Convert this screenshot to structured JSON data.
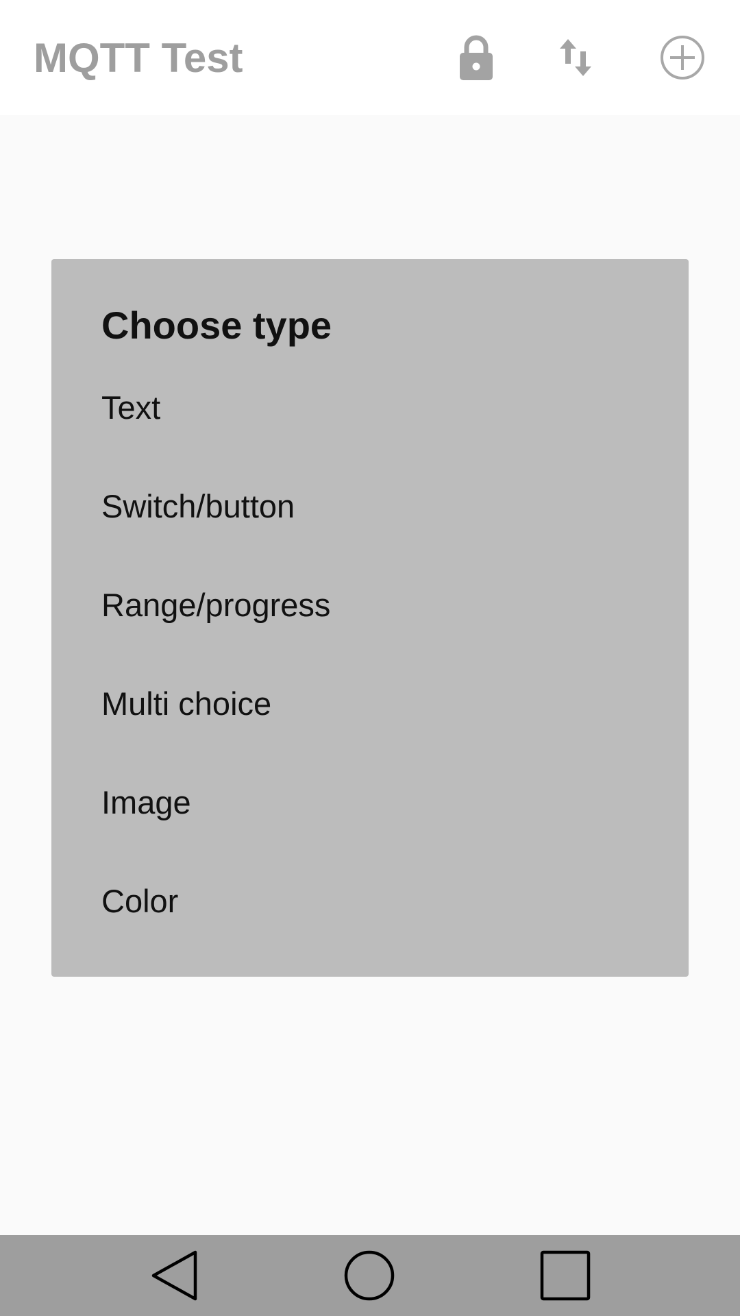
{
  "app_bar": {
    "title": "MQTT Test",
    "actions": [
      {
        "icon": "lock-icon"
      },
      {
        "icon": "swap-vertical-icon"
      },
      {
        "icon": "add-circle-icon"
      }
    ]
  },
  "dialog": {
    "title": "Choose type",
    "options": [
      "Text",
      "Switch/button",
      "Range/progress",
      "Multi choice",
      "Image",
      "Color"
    ]
  },
  "nav_bar": {
    "buttons": [
      {
        "icon": "back-triangle-icon"
      },
      {
        "icon": "home-circle-icon"
      },
      {
        "icon": "recents-square-icon"
      }
    ]
  },
  "colors": {
    "app_bar_bg": "#ffffff",
    "title_color": "#9e9e9e",
    "scrim_bg": "#fafafa",
    "dialog_bg": "#bcbcbc",
    "text_color": "#111111",
    "nav_bar_bg": "#9e9e9e"
  }
}
